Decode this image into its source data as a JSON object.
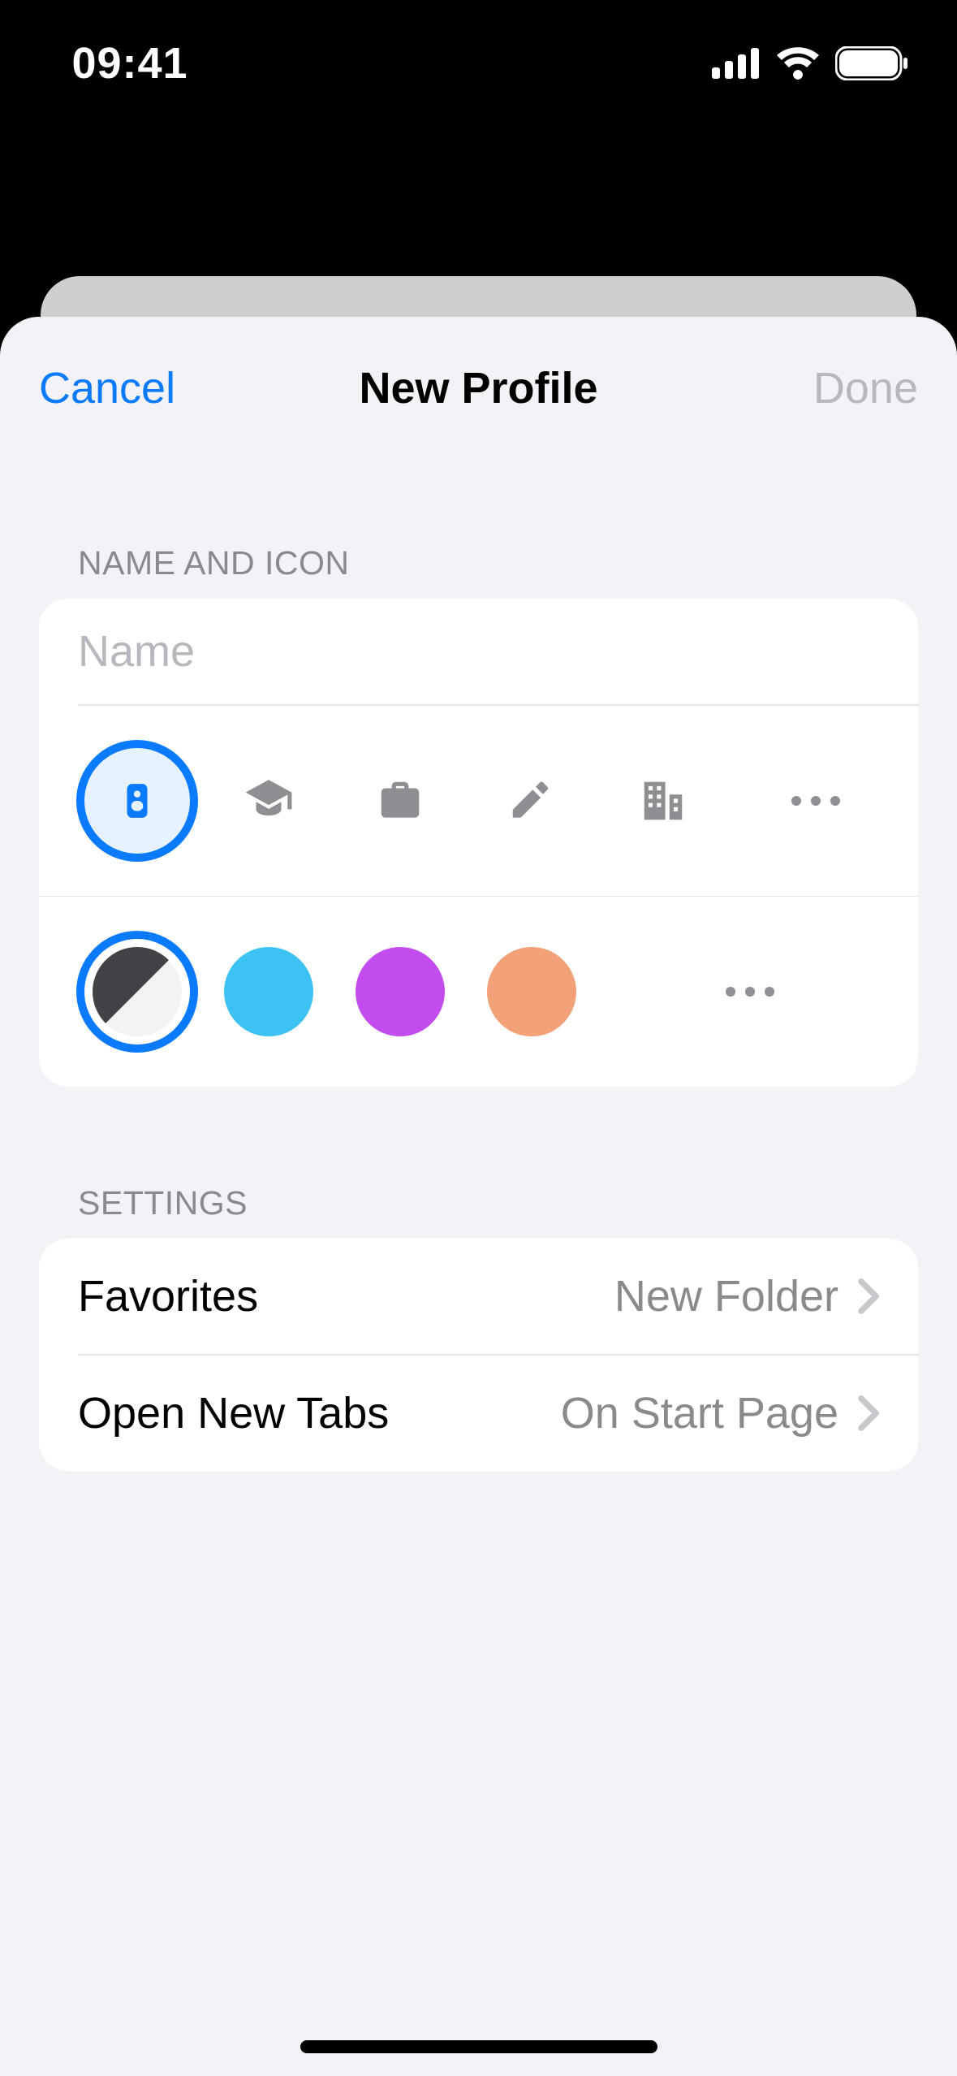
{
  "status": {
    "time": "09:41"
  },
  "nav": {
    "cancel": "Cancel",
    "title": "New Profile",
    "done": "Done"
  },
  "sections": {
    "name_icon_header": "NAME AND ICON",
    "settings_header": "SETTINGS"
  },
  "name_field": {
    "placeholder": "Name",
    "value": ""
  },
  "icons": {
    "selected": "badge",
    "options": [
      "badge",
      "graduation-cap",
      "briefcase",
      "hammer",
      "building"
    ]
  },
  "colors": {
    "selected": "default",
    "swatches": {
      "blue": "#3cc3f4",
      "purple": "#c24ced",
      "orange": "#f3a178"
    }
  },
  "settings": {
    "favorites": {
      "label": "Favorites",
      "value": "New Folder"
    },
    "open_new_tabs": {
      "label": "Open New Tabs",
      "value": "On Start Page"
    }
  }
}
